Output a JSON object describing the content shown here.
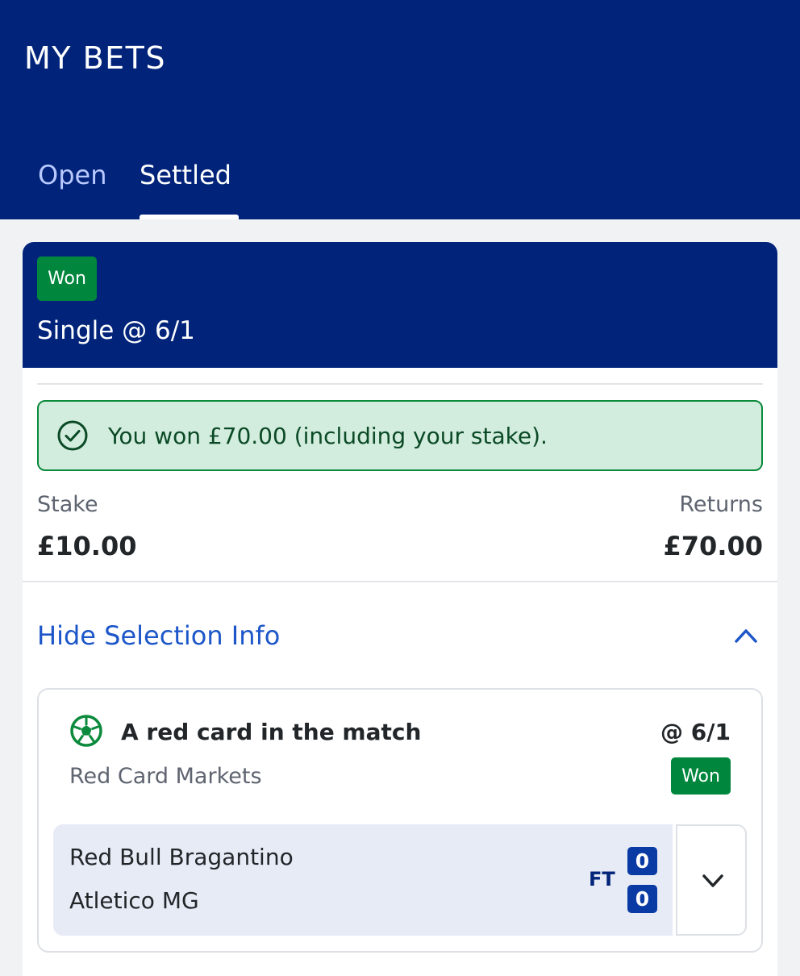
{
  "header": {
    "title": "MY BETS",
    "tabs": [
      {
        "label": "Open",
        "active": false
      },
      {
        "label": "Settled",
        "active": true
      }
    ]
  },
  "bet": {
    "status": "Won",
    "type": "Single @ 6/1",
    "win_message": "You won £70.00 (including your stake).",
    "stake_label": "Stake",
    "stake_value": "£10.00",
    "returns_label": "Returns",
    "returns_value": "£70.00",
    "toggle_label": "Hide Selection Info",
    "selection": {
      "name": "A red card in the match",
      "odds": "@ 6/1",
      "market": "Red Card Markets",
      "status": "Won",
      "match": {
        "home_team": "Red Bull Bragantino",
        "away_team": "Atletico MG",
        "period": "FT",
        "home_score": "0",
        "away_score": "0"
      }
    }
  },
  "colors": {
    "brand_navy": "#01247a",
    "won_green": "#00873d",
    "link_blue": "#1c56c8",
    "banner_bg": "#d2ecdd"
  },
  "icons": [
    "check-circle-icon",
    "chevron-up-icon",
    "soccer-ball-icon",
    "chevron-down-icon"
  ]
}
